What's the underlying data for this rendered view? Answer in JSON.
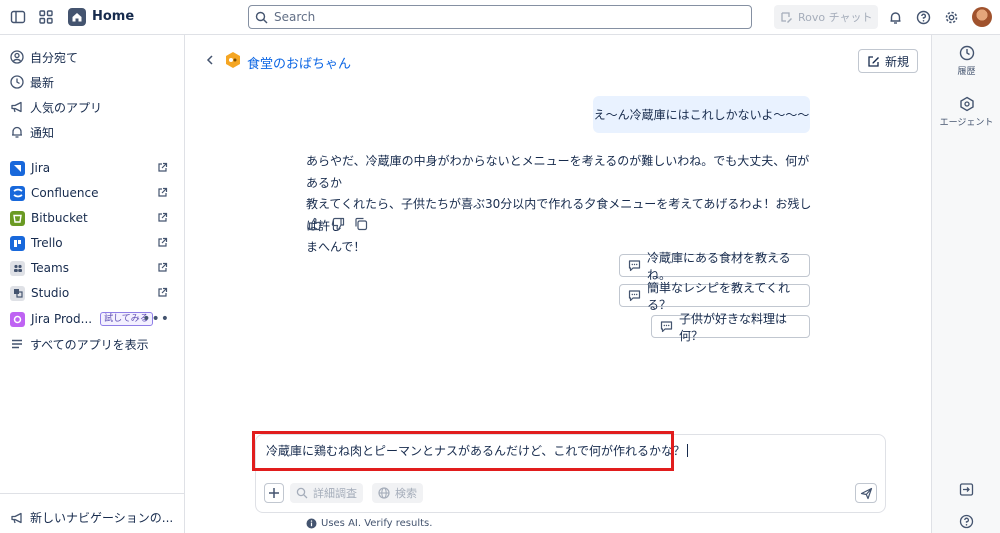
{
  "topbar": {
    "home_label": "Home",
    "search_placeholder": "Search",
    "rovo_label": "Rovo チャット"
  },
  "sidebar": {
    "nav": [
      {
        "label": "自分宛て",
        "icon": "user-circle-icon"
      },
      {
        "label": "最新",
        "icon": "clock-icon"
      },
      {
        "label": "人気のアプリ",
        "icon": "megaphone-icon"
      },
      {
        "label": "通知",
        "icon": "bell-icon"
      }
    ],
    "apps": [
      {
        "label": "Jira",
        "color": "#1868db"
      },
      {
        "label": "Confluence",
        "color": "#1868db"
      },
      {
        "label": "Bitbucket",
        "color": "#6a9a23"
      },
      {
        "label": "Trello",
        "color": "#1868db"
      },
      {
        "label": "Teams",
        "color": "#dfe1e6"
      },
      {
        "label": "Studio",
        "color": "#dfe1e6"
      },
      {
        "label": "Jira Prod...",
        "color": "#bf63f3",
        "badge": "試してみる"
      }
    ],
    "all_apps": "すべてのアプリを表示",
    "new_nav": "新しいナビゲーションの..."
  },
  "rail": {
    "history": "履歴",
    "agents": "エージェント"
  },
  "chat": {
    "agent_name": "食堂のおばちゃん",
    "new_button": "新規",
    "user_message": "え〜ん冷蔵庫にはこれしかないよ〜〜〜",
    "bot_message_lines": [
      "あらやだ、冷蔵庫の中身がわからないとメニューを考えるのが難しいわね。でも大丈夫、何があるか",
      "教えてくれたら、子供たちが喜ぶ30分以内で作れる夕食メニューを考えてあげるわよ！お残しは許し",
      "まへんで！"
    ],
    "suggestions": [
      "冷蔵庫にある食材を教えるね。",
      "簡単なレシピを教えてくれる？",
      "子供が好きな料理は何？"
    ],
    "input_value": "冷蔵庫に鶏むね肉とピーマンとナスがあるんだけど、これで何が作れるかな？",
    "deep_research": "詳細調査",
    "web_search": "検索",
    "disclaimer": "Uses AI. Verify results."
  }
}
